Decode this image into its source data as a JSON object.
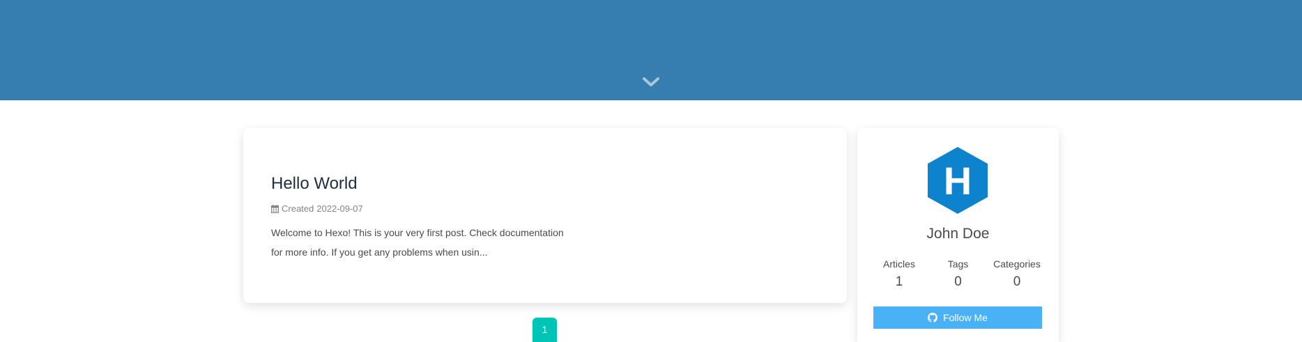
{
  "hero": {
    "scroll_down_icon": "chevron-down-icon",
    "background_color": "#357eaf"
  },
  "post": {
    "title": "Hello World",
    "meta_icon": "calendar-icon",
    "meta_label": "Created",
    "meta_date": "2022-09-07",
    "excerpt": "Welcome to Hexo! This is your very first post. Check documentation for more info. If you get any problems when usin..."
  },
  "pagination": {
    "current_page": "1",
    "accent_color": "#00c4b6"
  },
  "author": {
    "avatar_icon": "hexo-logo-icon",
    "avatar_letter": "H",
    "name": "John Doe",
    "stats": [
      {
        "label": "Articles",
        "value": "1"
      },
      {
        "label": "Tags",
        "value": "0"
      },
      {
        "label": "Categories",
        "value": "0"
      }
    ],
    "follow_icon": "github-icon",
    "follow_label": "Follow Me",
    "follow_color": "#49b1f5"
  }
}
